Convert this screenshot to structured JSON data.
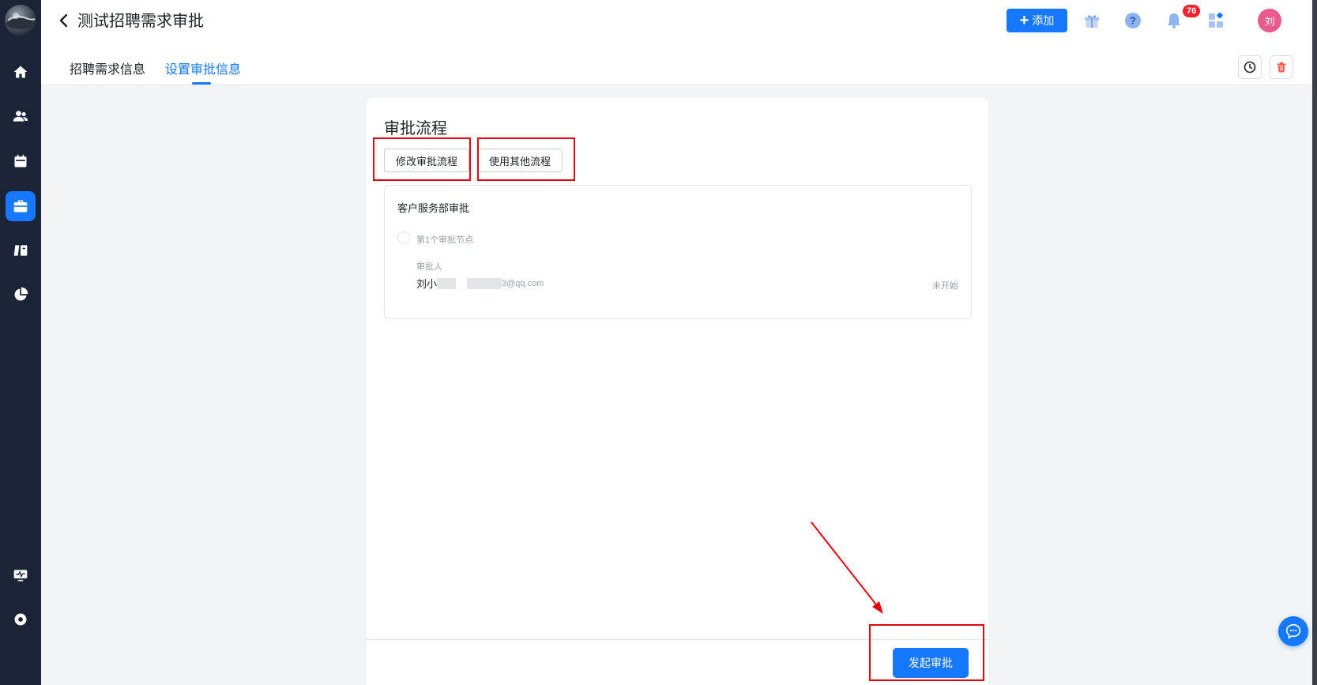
{
  "sidebar": {
    "items": [
      {
        "icon": "home-icon",
        "active": false
      },
      {
        "icon": "users-icon",
        "active": false
      },
      {
        "icon": "calendar-icon",
        "active": false
      },
      {
        "icon": "briefcase-icon",
        "active": true
      },
      {
        "icon": "book-icon",
        "active": false
      },
      {
        "icon": "pie-chart-icon",
        "active": false
      }
    ],
    "bottom_items": [
      {
        "icon": "monitor-icon"
      },
      {
        "icon": "settings-icon"
      }
    ]
  },
  "header": {
    "title": "测试招聘需求审批",
    "add_label": "添加",
    "notification_count": "76",
    "avatar_text": "刘",
    "tabs": [
      {
        "label": "招聘需求信息",
        "active": false
      },
      {
        "label": "设置审批信息",
        "active": true
      }
    ]
  },
  "card": {
    "title": "审批流程",
    "modify_button": "修改审批流程",
    "use_other_button": "使用其他流程",
    "flow": {
      "name": "客户服务部审批",
      "node_label": "第1个审批节点",
      "approver_label": "审批人",
      "approver_name": "刘小",
      "approver_email": "3@qq.com",
      "status": "未开始"
    }
  },
  "footer": {
    "submit_label": "发起审批"
  },
  "colors": {
    "primary": "#1677ff",
    "sidebar_bg": "#1b2437",
    "annotation_red": "#e60012",
    "badge_red": "#f5222d",
    "avatar_pink": "#ea5a8c"
  }
}
